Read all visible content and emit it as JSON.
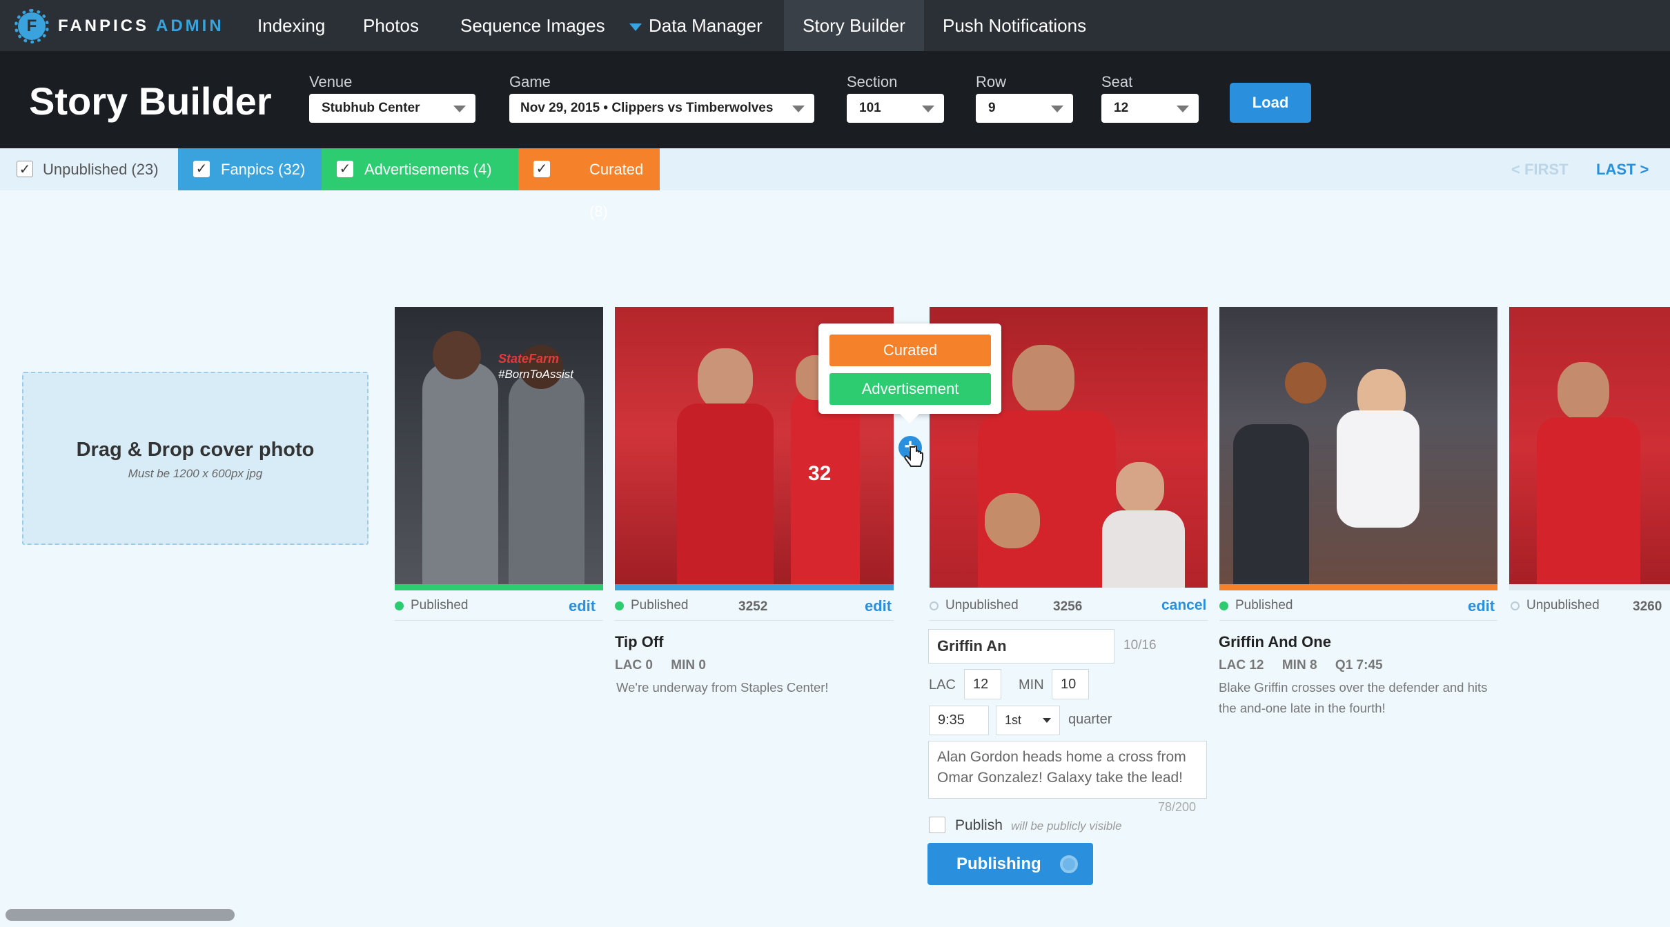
{
  "brand": {
    "name": "FANPICS",
    "suffix": "ADMIN",
    "icon": "gear-logo-icon"
  },
  "nav": {
    "indexing": "Indexing",
    "photos": "Photos",
    "sequence": "Sequence Images",
    "data_manager": "Data Manager",
    "story_builder": "Story Builder",
    "push": "Push Notifications"
  },
  "header": {
    "title": "Story Builder",
    "venue": {
      "label": "Venue",
      "value": "Stubhub Center"
    },
    "game": {
      "label": "Game",
      "value": "Nov 29, 2015 • Clippers vs Timberwolves"
    },
    "section": {
      "label": "Section",
      "value": "101"
    },
    "row": {
      "label": "Row",
      "value": "9"
    },
    "seat": {
      "label": "Seat",
      "value": "12"
    },
    "load": "Load"
  },
  "filters": {
    "unpublished": "Unpublished (23)",
    "fanpics": "Fanpics (32)",
    "advertisements": "Advertisements (4)",
    "curated": "Curated (8)",
    "first": "< FIRST",
    "last": "LAST >",
    "check": "✓"
  },
  "dropzone": {
    "title": "Drag & Drop cover photo",
    "subtitle": "Must  be 1200 x 600px jpg"
  },
  "cards": [
    {
      "status": "Published",
      "number": "",
      "action": "edit",
      "title": "",
      "score": "",
      "desc": ""
    },
    {
      "status": "Published",
      "number": "3252",
      "action": "edit",
      "title": "Tip Off",
      "score": "LAC 0     MIN 0",
      "desc": "We're underway from Staples Center!"
    },
    {
      "status": "Unpublished",
      "number": "3256",
      "action": "cancel"
    },
    {
      "status": "Published",
      "number": "",
      "action": "edit",
      "title": "Griffin And One",
      "score": "LAC 12     MIN 8     Q1 7:45",
      "desc": "Blake Griffin crosses over the defender and hits the and-one late in the fourth!"
    },
    {
      "status": "Unpublished",
      "number": "3260",
      "action": ""
    }
  ],
  "editor": {
    "title": "Griffin An",
    "title_count": "10/16",
    "lac_label": "LAC",
    "lac": "12",
    "min_label": "MIN",
    "min": "10",
    "time": "9:35",
    "quarter_value": "1st",
    "quarter_label": "quarter",
    "description": "Alan Gordon heads home a cross from Omar Gonzalez! Galaxy take the lead!",
    "desc_count": "78/200",
    "publish_label": "Publish",
    "publish_hint": "will be publicly visible",
    "publishing": "Publishing"
  },
  "popup": {
    "curated": "Curated",
    "advertisement": "Advertisement",
    "add": "+"
  },
  "photo_text": {
    "sponsor": "StateFarm",
    "hashtag": "#BornToAssist",
    "jersey": "32"
  },
  "colors": {
    "blue": "#2a8fdc",
    "green": "#2ecc71",
    "orange": "#f5822a",
    "fanpics": "#3aa3dd",
    "published_dot": "#2ecc71"
  }
}
